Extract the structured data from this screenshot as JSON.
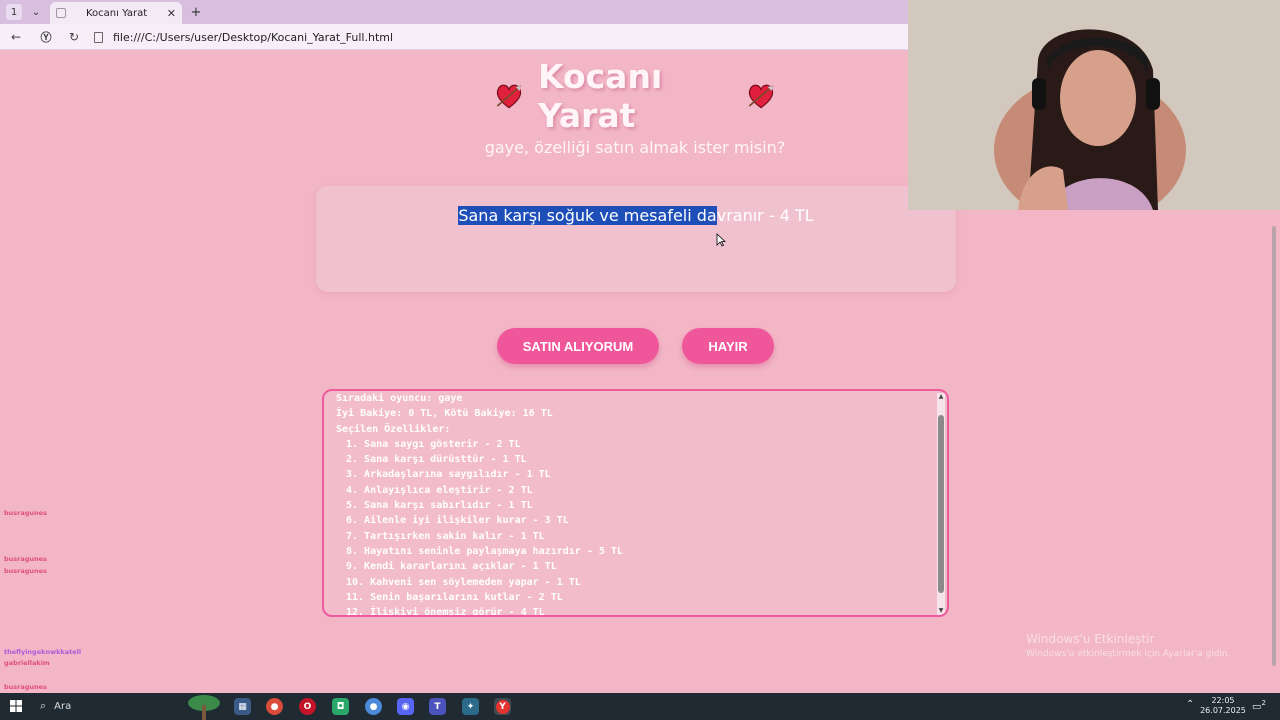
{
  "browser": {
    "tab_count": "1",
    "tab_title": "Kocanı Yarat",
    "url": "file:///C:/Users/user/Desktop/Kocani_Yarat_Full.html"
  },
  "page": {
    "title": "Kocanı Yarat",
    "subtitle": "gaye, özelliği satın almak ister misin?",
    "feature_selected": "Sana karşı soğuk ve mesafeli da",
    "feature_rest": "vranır - 4 TL",
    "buy_button": "SATIN ALIYORUM",
    "no_button": "HAYIR"
  },
  "log": {
    "current_player": "Sıradaki oyuncu: gaye",
    "balance": "İyi Bakiye: 0 TL, Kötü Bakiye: 16 TL",
    "selected_header": "Seçilen Özellikler:",
    "items": [
      "1. Sana saygı gösterir - 2 TL",
      "2. Sana karşı dürüsttür - 1 TL",
      "3. Arkadaşlarına saygılıdır - 1 TL",
      "4. Anlayışlıca eleştirir - 2 TL",
      "5. Sana karşı sabırlıdır - 1 TL",
      "6. Ailenle iyi ilişkiler kurar - 3 TL",
      "7. Tartışırken sakin kalır - 1 TL",
      "8. Hayatını seninle paylaşmaya hazırdır - 5 TL",
      "9. Kendi kararlarını açıklar - 1 TL",
      "10. Kahveni sen söylemeden yapar - 1 TL",
      "11. Senin başarılarını kutlar - 2 TL",
      "12. İlişkiyi önemsiz görür - 4 TL"
    ]
  },
  "watermark": {
    "line1": "Windows'u Etkinleştir",
    "line2": "Windows'u etkinleştirmek için Ayarlar'a gidin."
  },
  "chat": [
    {
      "user": "",
      "msg": "",
      "color": "#8fa0c8"
    },
    {
      "user": "busragunes",
      "msg": "",
      "color": "#e0507a"
    },
    {
      "user": "",
      "msg": "",
      "color": "#7ccf6a"
    },
    {
      "user": "",
      "msg": "",
      "color": "#8fa0c8"
    },
    {
      "user": "",
      "msg": "",
      "color": "#8fa0c8"
    },
    {
      "user": "busragunes",
      "msg": "",
      "color": "#e0507a"
    },
    {
      "user": "busragunes",
      "msg": "",
      "color": "#e0507a"
    },
    {
      "user": "",
      "msg": "",
      "color": "#7ccf6a"
    },
    {
      "user": "",
      "msg": "",
      "color": "#7ccf6a"
    },
    {
      "user": "",
      "msg": "",
      "color": "#8fa0c8"
    },
    {
      "user": "",
      "msg": "",
      "color": "#7ccf6a"
    },
    {
      "user": "",
      "msg": "",
      "color": "#7ccf6a"
    },
    {
      "user": "",
      "msg": "",
      "color": "#8fa0c8"
    },
    {
      "user": "theflyingeknwkkatell",
      "msg": "",
      "color": "#b05ad8"
    },
    {
      "user": "gabriellakim",
      "msg": "",
      "color": "#e0507a"
    },
    {
      "user": "",
      "msg": "",
      "color": "#7ccf6a"
    },
    {
      "user": "busragunes",
      "msg": "",
      "color": "#e0507a"
    },
    {
      "user": "busragunes",
      "msg": "",
      "color": "#e0507a"
    }
  ],
  "taskbar": {
    "search_label": "Ara",
    "time": "22:05",
    "date": "26.07.2025",
    "notif_count": "2"
  },
  "colors": {
    "page_bg": "#f2b6c7",
    "accent": "#f0569a",
    "selection": "#1e4fb8"
  }
}
